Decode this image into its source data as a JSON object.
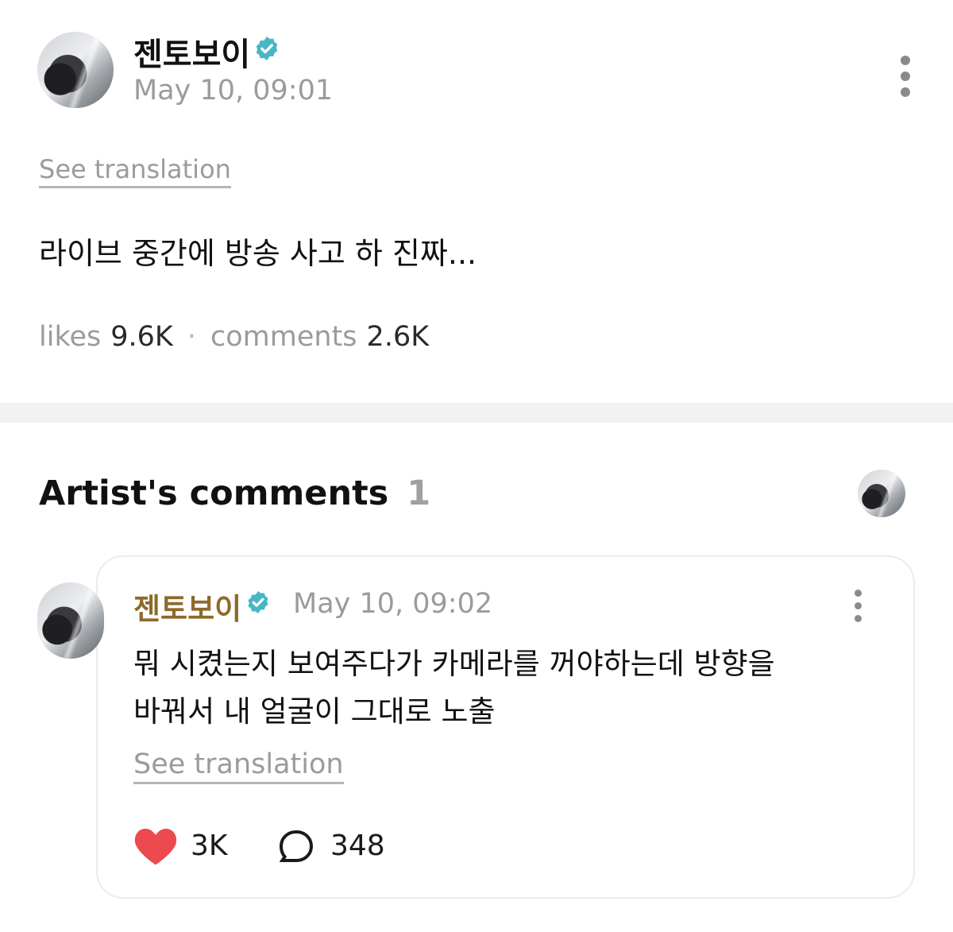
{
  "post": {
    "author": "젠토보이",
    "timestamp": "May 10, 09:01",
    "see_translation": "See translation",
    "text": "라이브 중간에 방송 사고 하 진짜...",
    "likes_label": "likes",
    "likes_count": "9.6K",
    "separator": "·",
    "comments_label": "comments",
    "comments_count": "2.6K",
    "icons": [
      "verified-icon",
      "more-options-icon"
    ]
  },
  "artist_comments": {
    "heading": "Artist's comments",
    "count": "1",
    "comment": {
      "author": "젠토보이",
      "timestamp": "May 10, 09:02",
      "text_line1": "뭐 시켰는지 보여주다가 카메라를 꺼야하는데 방향을",
      "text_line2": "바꿔서 내 얼굴이 그대로 노출",
      "see_translation": "See translation",
      "likes": "3K",
      "replies": "348",
      "icons": [
        "verified-icon",
        "more-options-icon",
        "heart-icon",
        "comment-bubble-icon"
      ]
    }
  },
  "colors": {
    "author_highlight": "#8d6a2b",
    "verified": "#49b6c5",
    "heart": "#ec4a4f",
    "muted_text": "#9b9b9b",
    "divider": "#f2f2f2"
  }
}
